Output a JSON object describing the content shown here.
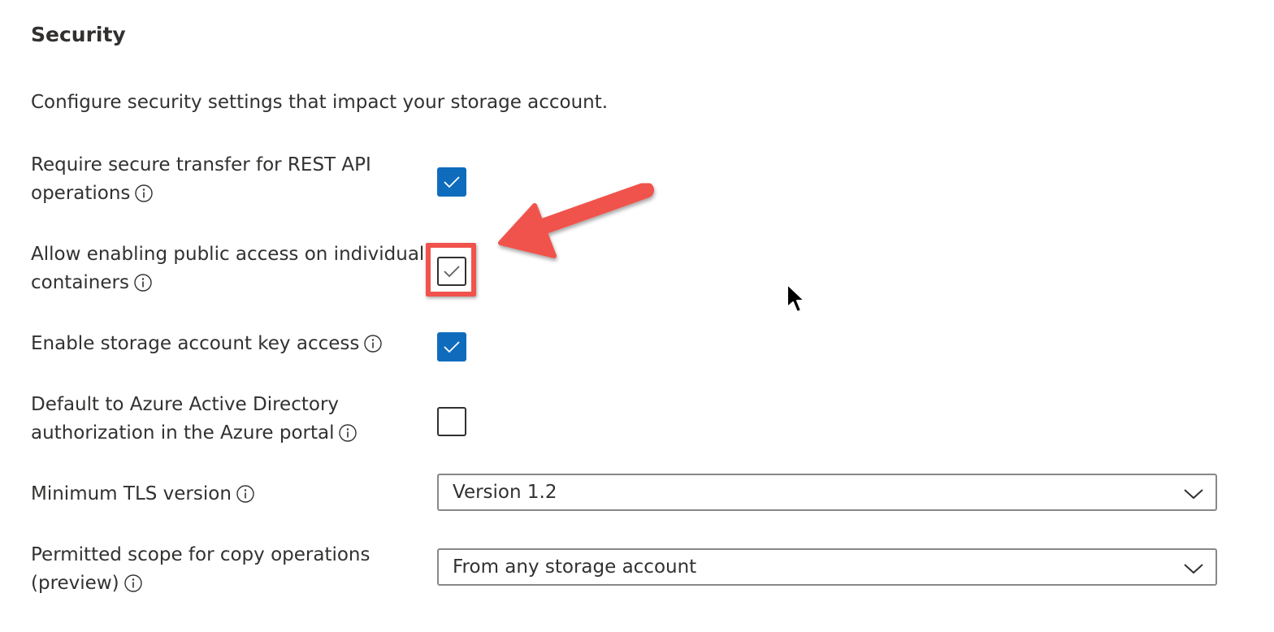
{
  "section": {
    "title": "Security",
    "description": "Configure security settings that impact your storage account."
  },
  "settings": [
    {
      "label_line1": "Require secure transfer for REST API",
      "label_line2": "operations",
      "state": "checked"
    },
    {
      "label_line1": "Allow enabling public access on individual",
      "label_line2": "containers",
      "state": "checked-highlighted"
    },
    {
      "label_line1": "Enable storage account key access",
      "state": "checked"
    },
    {
      "label_line1": "Default to Azure Active Directory",
      "label_line2": "authorization in the Azure portal",
      "state": "unchecked"
    }
  ],
  "dropdowns": {
    "tls": {
      "label": "Minimum TLS version",
      "value": "Version 1.2"
    },
    "copy_scope": {
      "label_line1": "Permitted scope for copy operations",
      "label_line2": "(preview)",
      "value": "From any storage account"
    }
  },
  "colors": {
    "checkbox_checked": "#0f6cbd",
    "annotation": "#f0524c",
    "text": "#323130"
  },
  "icons": [
    "info-icon",
    "checkmark-icon",
    "chevron-down-icon",
    "annotation-arrow",
    "mouse-cursor-icon"
  ]
}
